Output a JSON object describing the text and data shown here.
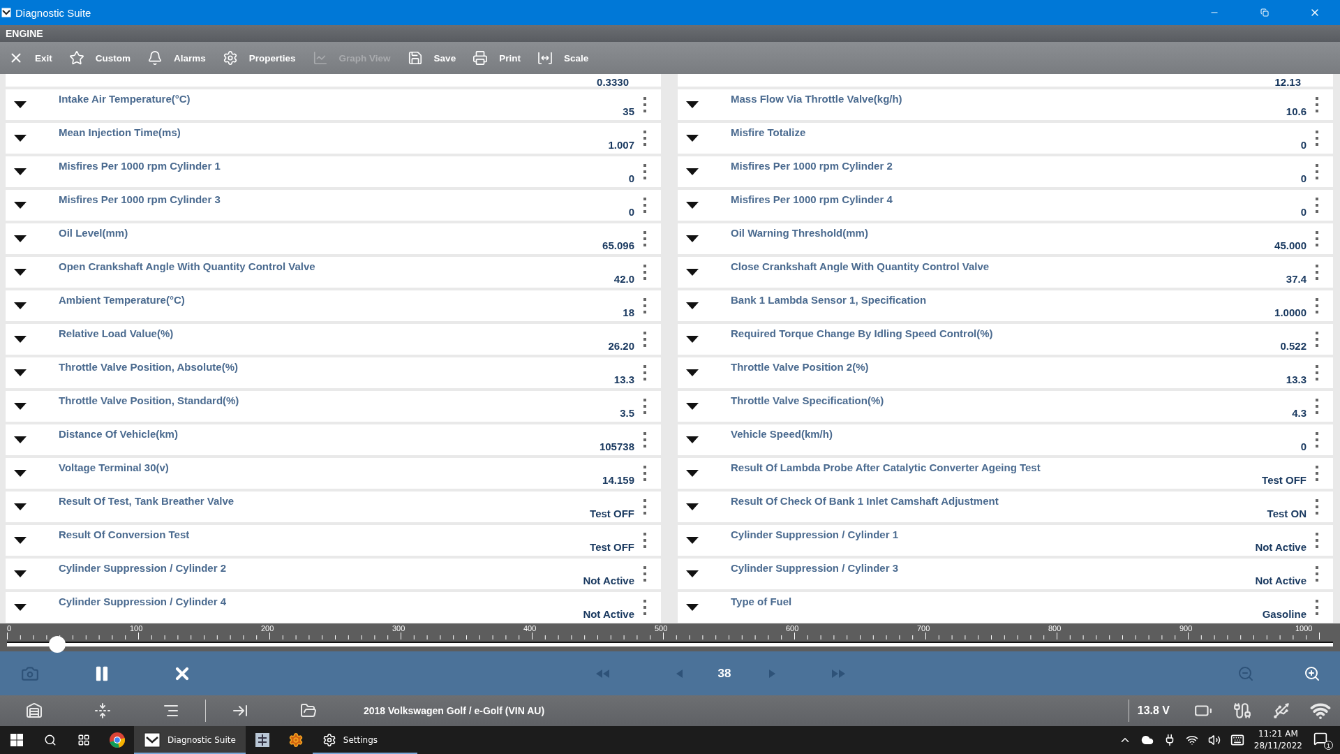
{
  "window": {
    "title": "Diagnostic Suite"
  },
  "module": "ENGINE",
  "toolbar": [
    {
      "kind": "exit",
      "label": "Exit",
      "disabled": false
    },
    {
      "kind": "custom",
      "label": "Custom",
      "disabled": false
    },
    {
      "kind": "alarms",
      "label": "Alarms",
      "disabled": false
    },
    {
      "kind": "properties",
      "label": "Properties",
      "disabled": false
    },
    {
      "kind": "graph",
      "label": "Graph View",
      "disabled": true
    },
    {
      "kind": "save",
      "label": "Save",
      "disabled": false
    },
    {
      "kind": "print",
      "label": "Print",
      "disabled": false
    },
    {
      "kind": "scale",
      "label": "Scale",
      "disabled": false
    }
  ],
  "columns": [
    {
      "partial_value": "0.3330",
      "rows": [
        {
          "name": "Intake Air Temperature(°C)",
          "value": "35"
        },
        {
          "name": "Mean Injection Time(ms)",
          "value": "1.007"
        },
        {
          "name": "Misfires Per 1000 rpm Cylinder 1",
          "value": "0"
        },
        {
          "name": "Misfires Per 1000 rpm Cylinder 3",
          "value": "0"
        },
        {
          "name": "Oil Level(mm)",
          "value": "65.096"
        },
        {
          "name": "Open Crankshaft Angle With Quantity Control Valve",
          "value": "42.0"
        },
        {
          "name": "Ambient Temperature(°C)",
          "value": "18"
        },
        {
          "name": "Relative Load Value(%)",
          "value": "26.20"
        },
        {
          "name": "Throttle Valve Position, Absolute(%)",
          "value": "13.3"
        },
        {
          "name": "Throttle Valve Position, Standard(%)",
          "value": "3.5"
        },
        {
          "name": "Distance Of Vehicle(km)",
          "value": "105738"
        },
        {
          "name": "Voltage Terminal 30(v)",
          "value": "14.159"
        },
        {
          "name": "Result Of Test, Tank Breather Valve",
          "value": "Test OFF"
        },
        {
          "name": "Result Of Conversion Test",
          "value": "Test OFF"
        },
        {
          "name": "Cylinder Suppression / Cylinder 2",
          "value": "Not Active"
        },
        {
          "name": "Cylinder Suppression / Cylinder 4",
          "value": "Not Active"
        }
      ]
    },
    {
      "partial_value": "12.13",
      "rows": [
        {
          "name": "Mass Flow Via Throttle Valve(kg/h)",
          "value": "10.6"
        },
        {
          "name": "Misfire Totalize",
          "value": "0"
        },
        {
          "name": "Misfires Per 1000 rpm Cylinder 2",
          "value": "0"
        },
        {
          "name": "Misfires Per 1000 rpm Cylinder 4",
          "value": "0"
        },
        {
          "name": "Oil Warning Threshold(mm)",
          "value": "45.000"
        },
        {
          "name": "Close Crankshaft Angle With Quantity Control Valve",
          "value": "37.4"
        },
        {
          "name": "Bank 1 Lambda Sensor 1, Specification",
          "value": "1.0000"
        },
        {
          "name": "Required Torque Change By Idling Speed Control(%)",
          "value": "0.522"
        },
        {
          "name": "Throttle Valve Position 2(%)",
          "value": "13.3"
        },
        {
          "name": "Throttle Valve Specification(%)",
          "value": "4.3"
        },
        {
          "name": "Vehicle Speed(km/h)",
          "value": "0"
        },
        {
          "name": "Result Of Lambda Probe After Catalytic Converter Ageing Test",
          "value": "Test OFF"
        },
        {
          "name": "Result Of Check Of Bank 1 Inlet Camshaft Adjustment",
          "value": "Test ON"
        },
        {
          "name": "Cylinder Suppression / Cylinder 1",
          "value": "Not Active"
        },
        {
          "name": "Cylinder Suppression / Cylinder 3",
          "value": "Not Active"
        },
        {
          "name": "Type of Fuel",
          "value": "Gasoline"
        }
      ]
    }
  ],
  "timeline": {
    "ticks": [
      "0",
      "100",
      "200",
      "300",
      "400",
      "500",
      "600",
      "700",
      "800",
      "900",
      "1000"
    ],
    "level": 0.038
  },
  "player": {
    "frame": "38",
    "buttons": [
      {
        "kind": "camera",
        "disabled": true
      },
      {
        "kind": "pause",
        "disabled": false
      },
      {
        "kind": "stop",
        "disabled": false
      },
      {
        "kind": "rewind",
        "disabled": true
      },
      {
        "kind": "prev",
        "disabled": true
      },
      {
        "kind": "frame"
      },
      {
        "kind": "next",
        "disabled": true
      },
      {
        "kind": "forward",
        "disabled": true
      },
      {
        "kind": "zoom_out",
        "disabled": true
      },
      {
        "kind": "zoom_in",
        "disabled": false
      }
    ]
  },
  "status": {
    "vehicle": "2018 Volkswagen Golf / e-Golf (VIN AU)",
    "voltage": "13.8 V"
  },
  "taskbar": {
    "apps": [
      {
        "kind": "chrome",
        "selected": false
      },
      {
        "kind": "suite",
        "label": "Diagnostic Suite",
        "selected": true
      },
      {
        "kind": "tool",
        "selected": false
      },
      {
        "kind": "gear",
        "selected": false
      },
      {
        "kind": "settings",
        "label": "Settings",
        "selected": false
      }
    ],
    "time": "11:21 AM",
    "date": "28/11/2022",
    "notifications": "1"
  }
}
